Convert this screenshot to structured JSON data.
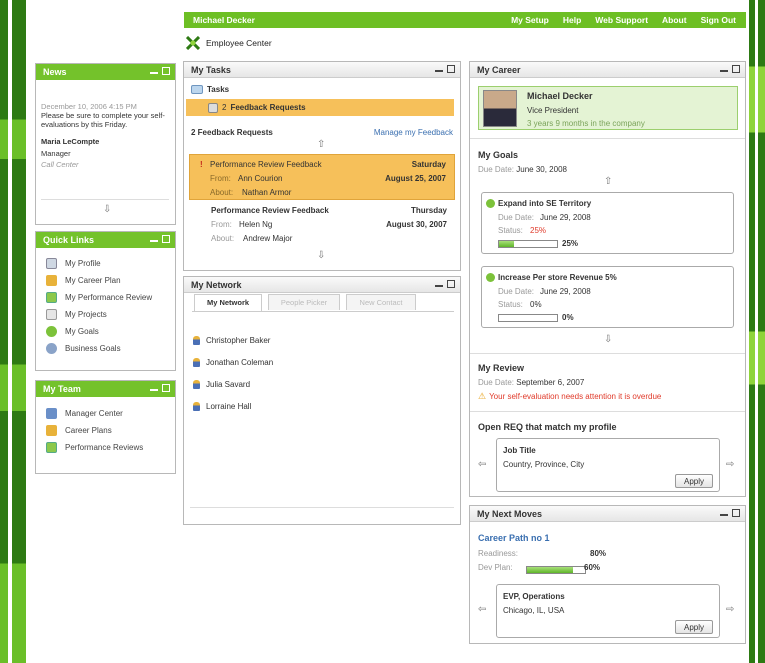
{
  "topbar": {
    "user": "Michael Decker",
    "links": [
      "My Setup",
      "Help",
      "Web Support",
      "About",
      "Sign Out"
    ]
  },
  "brand": {
    "label": "Employee Center"
  },
  "news": {
    "title": "News",
    "date": "December 10, 2006 4:15 PM",
    "message": "Please be sure to complete your self-evaluations by this Friday.",
    "author": "Maria LeCompte",
    "role": "Manager",
    "dept": "Call Center"
  },
  "quick_links": {
    "title": "Quick Links",
    "items": [
      "My Profile",
      "My Career Plan",
      "My Performance Review",
      "My Projects",
      "My Goals",
      "Business Goals"
    ]
  },
  "my_team": {
    "title": "My Team",
    "items": [
      "Manager Center",
      "Career Plans",
      "Performance Reviews"
    ]
  },
  "tasks": {
    "title": "My Tasks",
    "folder": "Tasks",
    "count": "2",
    "folder_item": "Feedback Requests",
    "summary": "2 Feedback Requests",
    "manage_link": "Manage my Feedback",
    "from_label": "From:",
    "about_label": "About:",
    "items": [
      {
        "title": "Performance Review Feedback",
        "day": "Saturday",
        "from": "Ann Courion",
        "date": "August 25, 2007",
        "about": "Nathan Armor"
      },
      {
        "title": "Performance Review Feedback",
        "day": "Thursday",
        "from": "Helen Ng",
        "date": "August 30, 2007",
        "about": "Andrew Major"
      }
    ]
  },
  "network": {
    "title": "My Network",
    "tabs": [
      "My Network",
      "People Picker",
      "New Contact"
    ],
    "people": [
      "Christopher Baker",
      "Jonathan Coleman",
      "Julia Savard",
      "Lorraine Hall"
    ]
  },
  "career": {
    "title": "My Career",
    "name": "Michael Decker",
    "position": "Vice President",
    "tenure": "3 years 9 months in the company",
    "goals_title": "My Goals",
    "due_label": "Due Date:",
    "status_label": "Status:",
    "goals_due": "June 30, 2008",
    "goals": [
      {
        "title": "Expand into SE Territory",
        "due": "June 29, 2008",
        "status": "25%",
        "progress": "25%",
        "progress_value": 25
      },
      {
        "title": "Increase Per store Revenue 5%",
        "due": "June 29, 2008",
        "status": "0%",
        "progress": "0%",
        "progress_value": 0
      }
    ],
    "review_title": "My Review",
    "review_due": "September 6, 2007",
    "review_warning": "Your self-evaluation needs attention it is overdue",
    "req_title": "Open REQ that match my profile",
    "req_job": "Job Title",
    "req_location": "Country, Province, City",
    "apply": "Apply"
  },
  "next_moves": {
    "title": "My Next Moves",
    "path": "Career Path no 1",
    "readiness_label": "Readiness:",
    "readiness": "80%",
    "readiness_value": 80,
    "dev_label": "Dev Plan:",
    "dev": "60%",
    "dev_value": 60,
    "job": "EVP, Operations",
    "location": "Chicago, IL, USA",
    "apply": "Apply"
  },
  "colors": {
    "brand_green": "#74c22b",
    "dark_green": "#2d7a13",
    "highlight": "#f6c05a",
    "warning": "#e03a2a"
  }
}
